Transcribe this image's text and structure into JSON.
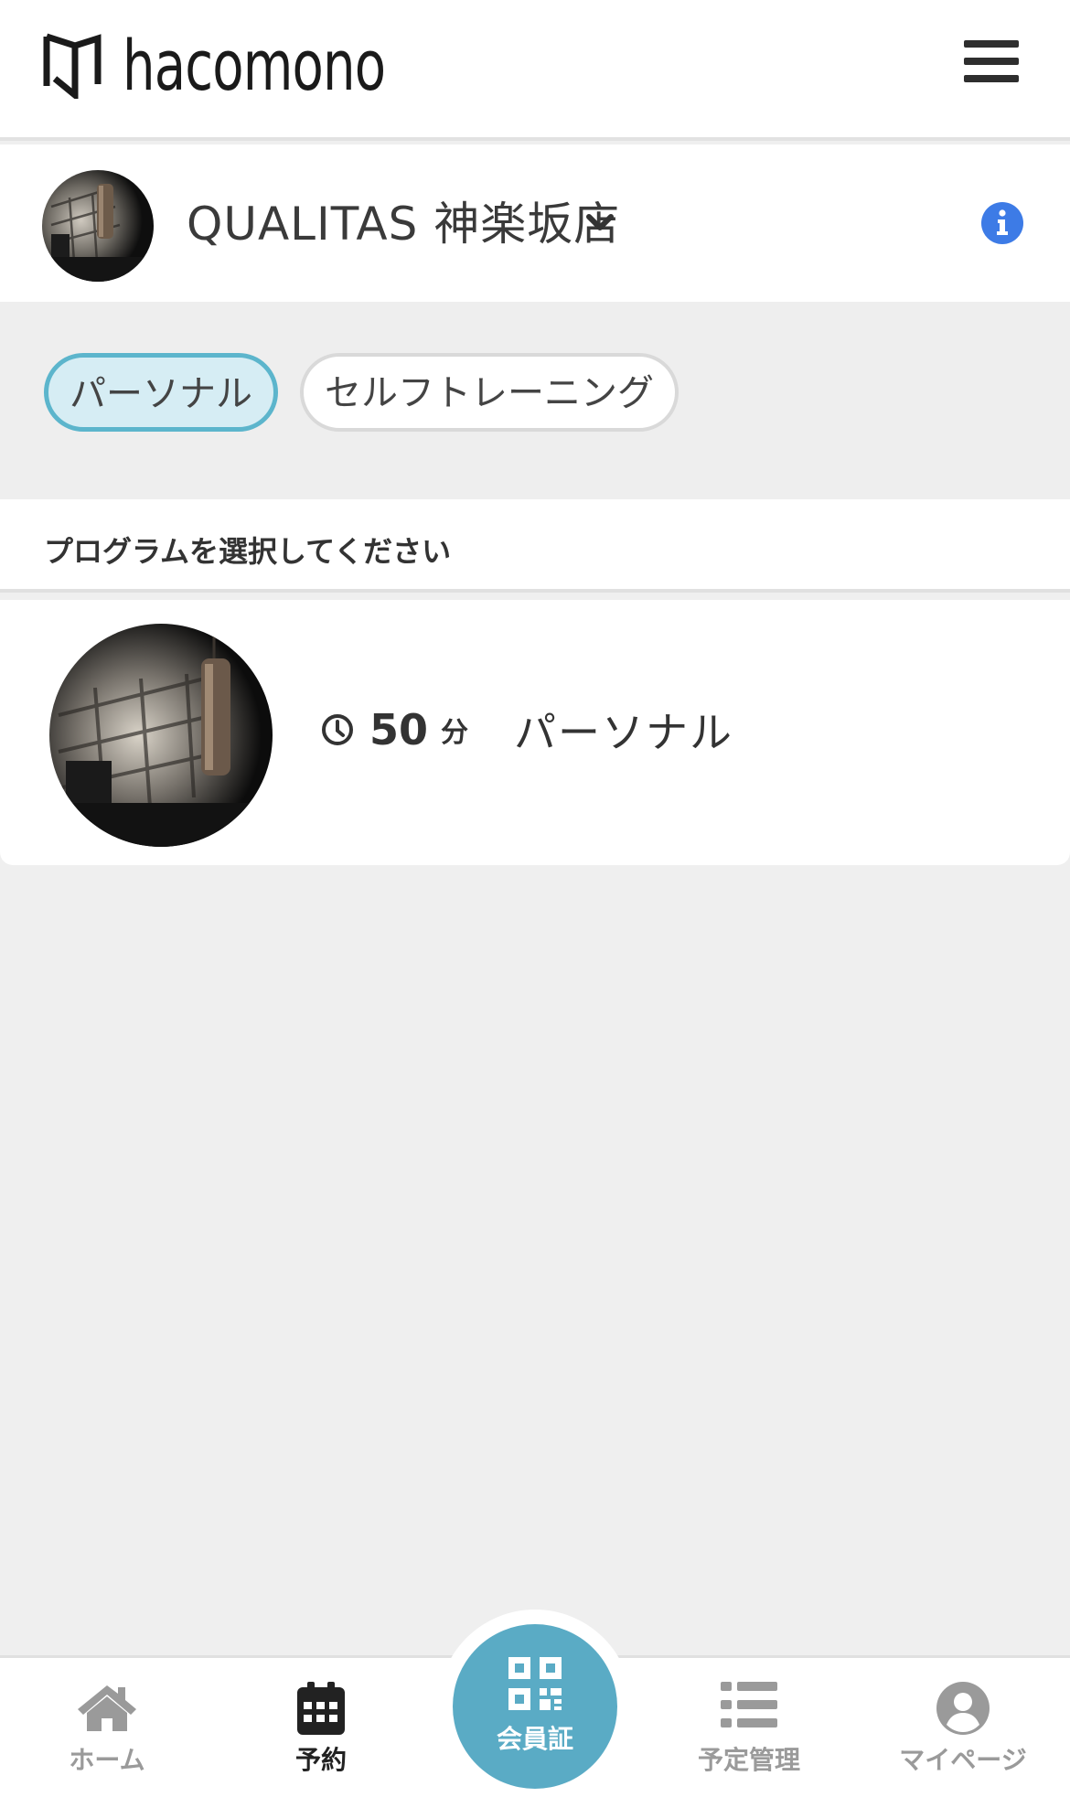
{
  "header": {
    "logo_text": "hacomono",
    "menu_icon": "hamburger-menu-icon"
  },
  "store": {
    "name": "QUALITAS 神楽坂店",
    "dropdown_icon": "chevron-down-icon",
    "info_icon": "info-icon",
    "info_color": "#3d7be6"
  },
  "categories": [
    {
      "label": "パーソナル",
      "selected": true
    },
    {
      "label": "セルフトレーニング",
      "selected": false
    }
  ],
  "section": {
    "title": "プログラムを選択してください"
  },
  "programs": [
    {
      "duration": "50",
      "unit": "分",
      "name": "パーソナル",
      "icon": "clock-icon"
    }
  ],
  "bottom_nav": {
    "items": [
      {
        "label": "ホーム",
        "icon": "home-icon",
        "active": false
      },
      {
        "label": "予約",
        "icon": "calendar-icon",
        "active": true
      },
      {
        "label": "会員証",
        "icon": "qr-code-icon",
        "active": false
      },
      {
        "label": "予定管理",
        "icon": "list-icon",
        "active": false
      },
      {
        "label": "マイページ",
        "icon": "user-icon",
        "active": false
      }
    ]
  },
  "colors": {
    "accent": "#5aabc5",
    "chip_active_bg": "#d6edf4",
    "background": "#efefef"
  }
}
